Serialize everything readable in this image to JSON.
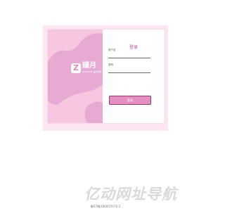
{
  "colors": {
    "background": "#ffffff",
    "outer_panel": "#fde6f1",
    "left_panel": "#f7c6e0",
    "blob": "#e7aad3",
    "accent": "#c2508f",
    "button_fill": "#e48fc0",
    "button_border": "#8e3b69"
  },
  "logo": {
    "mark": "Z",
    "name": "臻月",
    "sub": "ZHENYUE 品牌运营"
  },
  "form": {
    "title": "登录",
    "username_label": "用户名",
    "username_value": "",
    "password_label": "密码",
    "password_value": "",
    "submit_label": "登录"
  },
  "footer": {
    "watermark": "亿动网址导航",
    "icp": "豫ICP备19000747号-2"
  }
}
